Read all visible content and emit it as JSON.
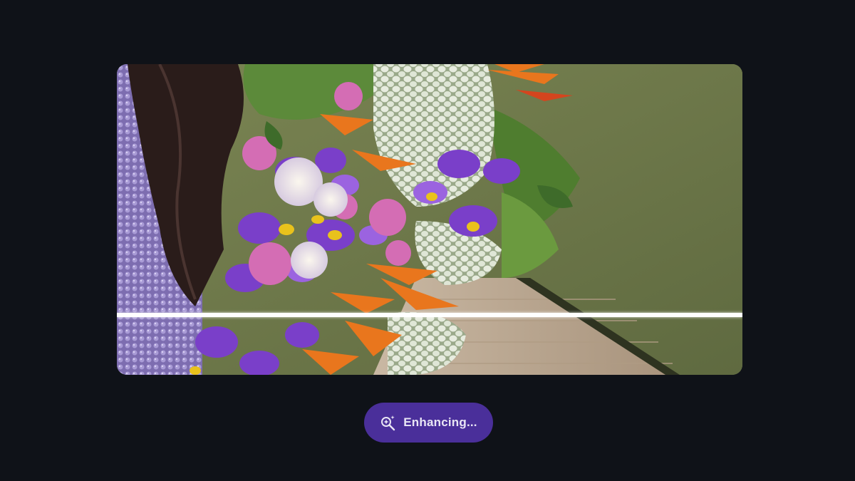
{
  "preview": {
    "image_description_icon": "photo-icon"
  },
  "status_pill": {
    "icon": "magic-enhance-icon",
    "label": "Enhancing...",
    "background": "#4a2f9a",
    "text_color": "#e9e6f5"
  },
  "colors": {
    "page_background": "#0f1218",
    "scan_line": "#ffffff",
    "wall_green": "#6f7a4c",
    "sequin_purple": "#8a7bb8"
  }
}
